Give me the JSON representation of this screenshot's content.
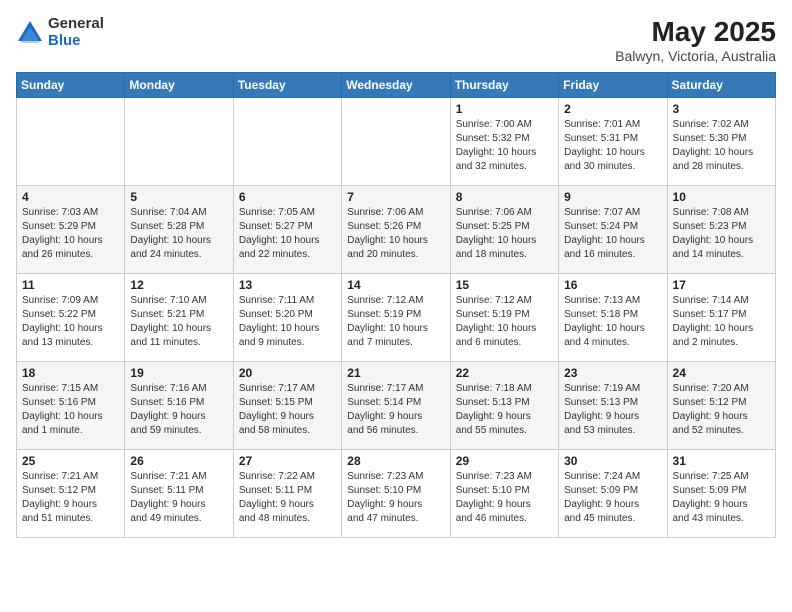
{
  "header": {
    "logo_general": "General",
    "logo_blue": "Blue",
    "title": "May 2025",
    "subtitle": "Balwyn, Victoria, Australia"
  },
  "weekdays": [
    "Sunday",
    "Monday",
    "Tuesday",
    "Wednesday",
    "Thursday",
    "Friday",
    "Saturday"
  ],
  "weeks": [
    [
      {
        "day": "",
        "info": ""
      },
      {
        "day": "",
        "info": ""
      },
      {
        "day": "",
        "info": ""
      },
      {
        "day": "",
        "info": ""
      },
      {
        "day": "1",
        "info": "Sunrise: 7:00 AM\nSunset: 5:32 PM\nDaylight: 10 hours\nand 32 minutes."
      },
      {
        "day": "2",
        "info": "Sunrise: 7:01 AM\nSunset: 5:31 PM\nDaylight: 10 hours\nand 30 minutes."
      },
      {
        "day": "3",
        "info": "Sunrise: 7:02 AM\nSunset: 5:30 PM\nDaylight: 10 hours\nand 28 minutes."
      }
    ],
    [
      {
        "day": "4",
        "info": "Sunrise: 7:03 AM\nSunset: 5:29 PM\nDaylight: 10 hours\nand 26 minutes."
      },
      {
        "day": "5",
        "info": "Sunrise: 7:04 AM\nSunset: 5:28 PM\nDaylight: 10 hours\nand 24 minutes."
      },
      {
        "day": "6",
        "info": "Sunrise: 7:05 AM\nSunset: 5:27 PM\nDaylight: 10 hours\nand 22 minutes."
      },
      {
        "day": "7",
        "info": "Sunrise: 7:06 AM\nSunset: 5:26 PM\nDaylight: 10 hours\nand 20 minutes."
      },
      {
        "day": "8",
        "info": "Sunrise: 7:06 AM\nSunset: 5:25 PM\nDaylight: 10 hours\nand 18 minutes."
      },
      {
        "day": "9",
        "info": "Sunrise: 7:07 AM\nSunset: 5:24 PM\nDaylight: 10 hours\nand 16 minutes."
      },
      {
        "day": "10",
        "info": "Sunrise: 7:08 AM\nSunset: 5:23 PM\nDaylight: 10 hours\nand 14 minutes."
      }
    ],
    [
      {
        "day": "11",
        "info": "Sunrise: 7:09 AM\nSunset: 5:22 PM\nDaylight: 10 hours\nand 13 minutes."
      },
      {
        "day": "12",
        "info": "Sunrise: 7:10 AM\nSunset: 5:21 PM\nDaylight: 10 hours\nand 11 minutes."
      },
      {
        "day": "13",
        "info": "Sunrise: 7:11 AM\nSunset: 5:20 PM\nDaylight: 10 hours\nand 9 minutes."
      },
      {
        "day": "14",
        "info": "Sunrise: 7:12 AM\nSunset: 5:19 PM\nDaylight: 10 hours\nand 7 minutes."
      },
      {
        "day": "15",
        "info": "Sunrise: 7:12 AM\nSunset: 5:19 PM\nDaylight: 10 hours\nand 6 minutes."
      },
      {
        "day": "16",
        "info": "Sunrise: 7:13 AM\nSunset: 5:18 PM\nDaylight: 10 hours\nand 4 minutes."
      },
      {
        "day": "17",
        "info": "Sunrise: 7:14 AM\nSunset: 5:17 PM\nDaylight: 10 hours\nand 2 minutes."
      }
    ],
    [
      {
        "day": "18",
        "info": "Sunrise: 7:15 AM\nSunset: 5:16 PM\nDaylight: 10 hours\nand 1 minute."
      },
      {
        "day": "19",
        "info": "Sunrise: 7:16 AM\nSunset: 5:16 PM\nDaylight: 9 hours\nand 59 minutes."
      },
      {
        "day": "20",
        "info": "Sunrise: 7:17 AM\nSunset: 5:15 PM\nDaylight: 9 hours\nand 58 minutes."
      },
      {
        "day": "21",
        "info": "Sunrise: 7:17 AM\nSunset: 5:14 PM\nDaylight: 9 hours\nand 56 minutes."
      },
      {
        "day": "22",
        "info": "Sunrise: 7:18 AM\nSunset: 5:13 PM\nDaylight: 9 hours\nand 55 minutes."
      },
      {
        "day": "23",
        "info": "Sunrise: 7:19 AM\nSunset: 5:13 PM\nDaylight: 9 hours\nand 53 minutes."
      },
      {
        "day": "24",
        "info": "Sunrise: 7:20 AM\nSunset: 5:12 PM\nDaylight: 9 hours\nand 52 minutes."
      }
    ],
    [
      {
        "day": "25",
        "info": "Sunrise: 7:21 AM\nSunset: 5:12 PM\nDaylight: 9 hours\nand 51 minutes."
      },
      {
        "day": "26",
        "info": "Sunrise: 7:21 AM\nSunset: 5:11 PM\nDaylight: 9 hours\nand 49 minutes."
      },
      {
        "day": "27",
        "info": "Sunrise: 7:22 AM\nSunset: 5:11 PM\nDaylight: 9 hours\nand 48 minutes."
      },
      {
        "day": "28",
        "info": "Sunrise: 7:23 AM\nSunset: 5:10 PM\nDaylight: 9 hours\nand 47 minutes."
      },
      {
        "day": "29",
        "info": "Sunrise: 7:23 AM\nSunset: 5:10 PM\nDaylight: 9 hours\nand 46 minutes."
      },
      {
        "day": "30",
        "info": "Sunrise: 7:24 AM\nSunset: 5:09 PM\nDaylight: 9 hours\nand 45 minutes."
      },
      {
        "day": "31",
        "info": "Sunrise: 7:25 AM\nSunset: 5:09 PM\nDaylight: 9 hours\nand 43 minutes."
      }
    ]
  ]
}
